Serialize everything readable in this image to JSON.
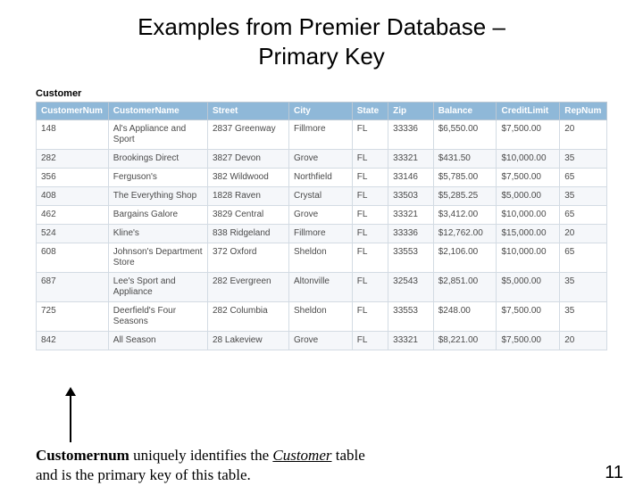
{
  "title_line1": "Examples from Premier Database –",
  "title_line2": "Primary Key",
  "table_name": "Customer",
  "columns": [
    "CustomerNum",
    "CustomerName",
    "Street",
    "City",
    "State",
    "Zip",
    "Balance",
    "CreditLimit",
    "RepNum"
  ],
  "rows": [
    {
      "num": "148",
      "name": "Al's Appliance and Sport",
      "street": "2837 Greenway",
      "city": "Fillmore",
      "state": "FL",
      "zip": "33336",
      "balance": "$6,550.00",
      "credit": "$7,500.00",
      "rep": "20"
    },
    {
      "num": "282",
      "name": "Brookings Direct",
      "street": "3827 Devon",
      "city": "Grove",
      "state": "FL",
      "zip": "33321",
      "balance": "$431.50",
      "credit": "$10,000.00",
      "rep": "35"
    },
    {
      "num": "356",
      "name": "Ferguson's",
      "street": "382 Wildwood",
      "city": "Northfield",
      "state": "FL",
      "zip": "33146",
      "balance": "$5,785.00",
      "credit": "$7,500.00",
      "rep": "65"
    },
    {
      "num": "408",
      "name": "The Everything Shop",
      "street": "1828 Raven",
      "city": "Crystal",
      "state": "FL",
      "zip": "33503",
      "balance": "$5,285.25",
      "credit": "$5,000.00",
      "rep": "35"
    },
    {
      "num": "462",
      "name": "Bargains Galore",
      "street": "3829 Central",
      "city": "Grove",
      "state": "FL",
      "zip": "33321",
      "balance": "$3,412.00",
      "credit": "$10,000.00",
      "rep": "65"
    },
    {
      "num": "524",
      "name": "Kline's",
      "street": "838 Ridgeland",
      "city": "Fillmore",
      "state": "FL",
      "zip": "33336",
      "balance": "$12,762.00",
      "credit": "$15,000.00",
      "rep": "20"
    },
    {
      "num": "608",
      "name": "Johnson's Department Store",
      "street": "372 Oxford",
      "city": "Sheldon",
      "state": "FL",
      "zip": "33553",
      "balance": "$2,106.00",
      "credit": "$10,000.00",
      "rep": "65"
    },
    {
      "num": "687",
      "name": "Lee's Sport and Appliance",
      "street": "282 Evergreen",
      "city": "Altonville",
      "state": "FL",
      "zip": "32543",
      "balance": "$2,851.00",
      "credit": "$5,000.00",
      "rep": "35"
    },
    {
      "num": "725",
      "name": "Deerfield's Four Seasons",
      "street": "282 Columbia",
      "city": "Sheldon",
      "state": "FL",
      "zip": "33553",
      "balance": "$248.00",
      "credit": "$7,500.00",
      "rep": "35"
    },
    {
      "num": "842",
      "name": "All Season",
      "street": "28 Lakeview",
      "city": "Grove",
      "state": "FL",
      "zip": "33321",
      "balance": "$8,221.00",
      "credit": "$7,500.00",
      "rep": "20"
    }
  ],
  "caption_bold": "Customernum",
  "caption_mid": " uniquely identifies the ",
  "caption_italic": "Customer",
  "caption_end1": " table",
  "caption_end2": "and is the primary key of this table.",
  "page_number": "11"
}
